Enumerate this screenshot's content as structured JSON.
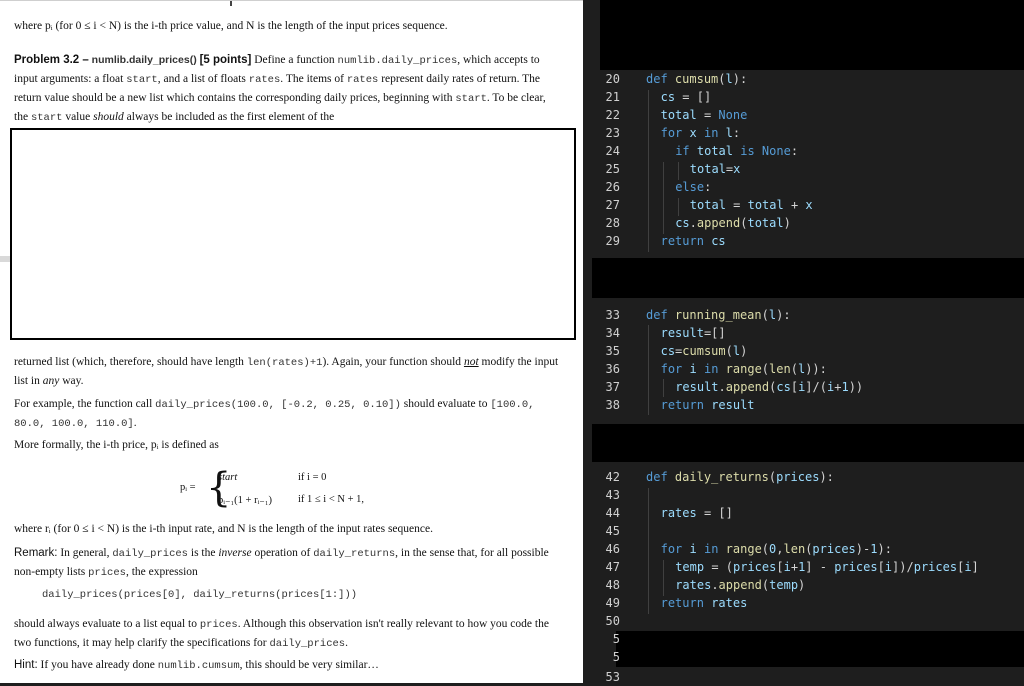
{
  "document": {
    "intro": "where pᵢ (for 0 ≤ i < N) is the i-th price value, and N is the length of the input prices sequence.",
    "problem": {
      "heading": "Problem 3.2 –",
      "func": "numlib.daily_prices()",
      "points": "[5 points]",
      "text_1": "Define a function",
      "code_1": "numlib.daily_prices",
      "text_2": ", which accepts to input arguments: a float",
      "code_2": "start",
      "text_3": ", and a list of floats",
      "code_3": "rates",
      "text_4": ". The items of",
      "code_4": "rates",
      "text_5": "represent daily rates of return. The return value should be a new list which contains the corresponding daily prices, beginning with",
      "code_5": "start",
      "text_6": ". To be clear, the",
      "code_6": "start",
      "text_7": "value",
      "italic_1": "should",
      "text_8": "always be included as the first element of the"
    },
    "returned": {
      "text_1": "returned list (which, therefore, should have length",
      "code_1": "len(rates)+1",
      "text_2": "). Again, your function should",
      "emph": "not",
      "text_3": "modify the input list in",
      "emph2": "any",
      "text_4": "way."
    },
    "example": {
      "text_1": "For example, the function call",
      "code_1": "daily_prices(100.0, [-0.2, 0.25, 0.10])",
      "text_2": "should evaluate to",
      "code_2": "[100.0, 80.0, 100.0, 110.0]",
      "text_3": "."
    },
    "formally": "More formally, the i-th price, pᵢ is defined as",
    "formula": {
      "lhs": "pᵢ =",
      "case1": "start",
      "cond1": "if i = 0",
      "case2": "pᵢ₋₁(1 + rᵢ₋₁)",
      "cond2": "if 1 ≤ i < N + 1",
      "tail": ","
    },
    "where_r": "where rᵢ (for 0 ≤ i < N) is the i-th input rate, and N is the length of the input rates sequence.",
    "remark": {
      "label": "Remark:",
      "text_1": "In general,",
      "code_1": "daily_prices",
      "text_2": "is the",
      "italic": "inverse",
      "text_3": "operation of",
      "code_2": "daily_returns",
      "text_4": ", in the sense that, for all possible non-empty lists",
      "code_3": "prices",
      "text_5": ", the expression"
    },
    "expression": "daily_prices(prices[0], daily_returns(prices[1:]))",
    "should": {
      "text_1": "should always evaluate to a list equal to",
      "code_1": "prices",
      "text_2": ". Although this observation isn't really relevant to how you code the two functions, it may help clarify the specifications for",
      "code_2": "daily_prices",
      "text_3": "."
    },
    "hint": {
      "label": "Hint:",
      "text_1": "If you have already done",
      "code_1": "numlib.cumsum",
      "text_2": ", this should be very similar…"
    }
  },
  "editor": {
    "colors": {
      "background": "#1e1e1e",
      "keyword": "#569cd6",
      "function": "#dcdcaa",
      "variable": "#9cdcfe",
      "line_number": "#d0d0d0"
    },
    "lines": [
      {
        "n": "20",
        "code": "def cumsum(l):"
      },
      {
        "n": "21",
        "code": "cs = []"
      },
      {
        "n": "22",
        "code": "total = None"
      },
      {
        "n": "23",
        "code": "for x in l:"
      },
      {
        "n": "24",
        "code": "if total is None:"
      },
      {
        "n": "25",
        "code": "total=x"
      },
      {
        "n": "26",
        "code": "else:"
      },
      {
        "n": "27",
        "code": "total = total + x"
      },
      {
        "n": "28",
        "code": "cs.append(total)"
      },
      {
        "n": "29",
        "code": "return cs"
      },
      {
        "n": "33",
        "code": "def running_mean(l):"
      },
      {
        "n": "34",
        "code": "result=[]"
      },
      {
        "n": "35",
        "code": "cs=cumsum(l)"
      },
      {
        "n": "36",
        "code": "for i in range(len(l)):"
      },
      {
        "n": "37",
        "code": "result.append(cs[i]/(i+1))"
      },
      {
        "n": "38",
        "code": "return result"
      },
      {
        "n": "42",
        "code": "def daily_returns(prices):"
      },
      {
        "n": "43",
        "code": ""
      },
      {
        "n": "44",
        "code": "rates = []"
      },
      {
        "n": "45",
        "code": ""
      },
      {
        "n": "46",
        "code": "for i in range(0,len(prices)-1):"
      },
      {
        "n": "47",
        "code": "temp = (prices[i+1] - prices[i])/prices[i]"
      },
      {
        "n": "48",
        "code": "rates.append(temp)"
      },
      {
        "n": "49",
        "code": "return rates"
      },
      {
        "n": "50",
        "code": ""
      },
      {
        "n": "5",
        "code": ""
      },
      {
        "n": "5",
        "code": ""
      },
      {
        "n": "53",
        "code": ""
      }
    ]
  }
}
